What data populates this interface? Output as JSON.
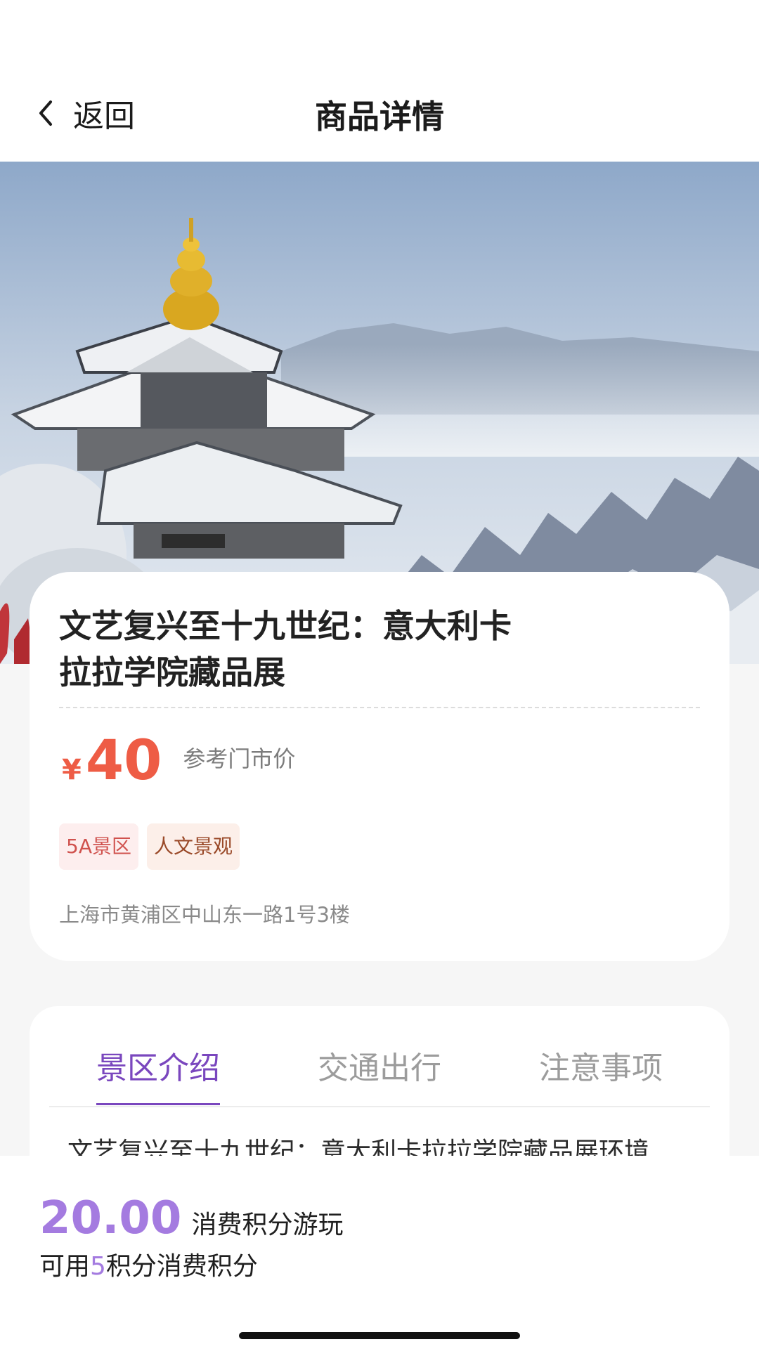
{
  "nav": {
    "back_label": "返回",
    "title": "商品详情",
    "back_icon": "chevron-left-icon"
  },
  "product": {
    "title_line1": "文艺复兴至十九世纪：意大利卡",
    "title_line2": "拉拉学院藏品展",
    "currency": "¥",
    "price": "40",
    "price_note": "参考门市价",
    "tags": [
      "5A景区",
      "人文景观"
    ],
    "address": "上海市黄浦区中山东一路1号3楼"
  },
  "tabs": [
    {
      "label": "景区介绍",
      "active": true
    },
    {
      "label": "交通出行",
      "active": false
    },
    {
      "label": "注意事项",
      "active": false
    }
  ],
  "intro_text": "文艺复兴至十九世纪：意大利卡拉拉学院藏品展环境",
  "bottom": {
    "points": "20.00",
    "points_label": "消费积分游玩",
    "avail_prefix": "可用",
    "avail_num": "5",
    "avail_suffix": "积分消费积分"
  },
  "colors": {
    "accent_purple": "#7a47be",
    "price_red": "#ee5c45",
    "points_purple": "#a47be0"
  }
}
